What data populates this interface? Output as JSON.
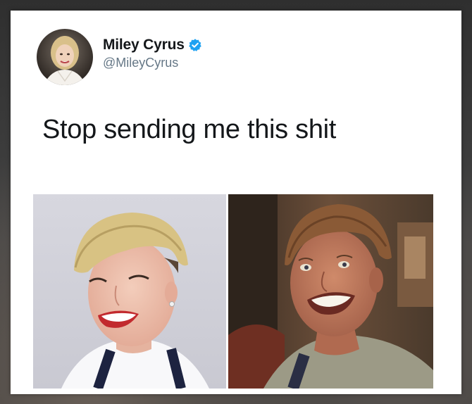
{
  "tweet": {
    "author": {
      "name": "Miley Cyrus",
      "handle": "@MileyCyrus",
      "verified": true,
      "avatar_icon": "avatar-photo"
    },
    "text": "Stop sending me this shit",
    "media": [
      {
        "icon": "photo-smiling-blonde-bowl-cut"
      },
      {
        "icon": "photo-smiling-man-bowl-cut"
      }
    ]
  },
  "colors": {
    "verified_badge": "#1da1f2",
    "name_text": "#14171a",
    "handle_text": "#657786",
    "card_background": "#ffffff"
  }
}
